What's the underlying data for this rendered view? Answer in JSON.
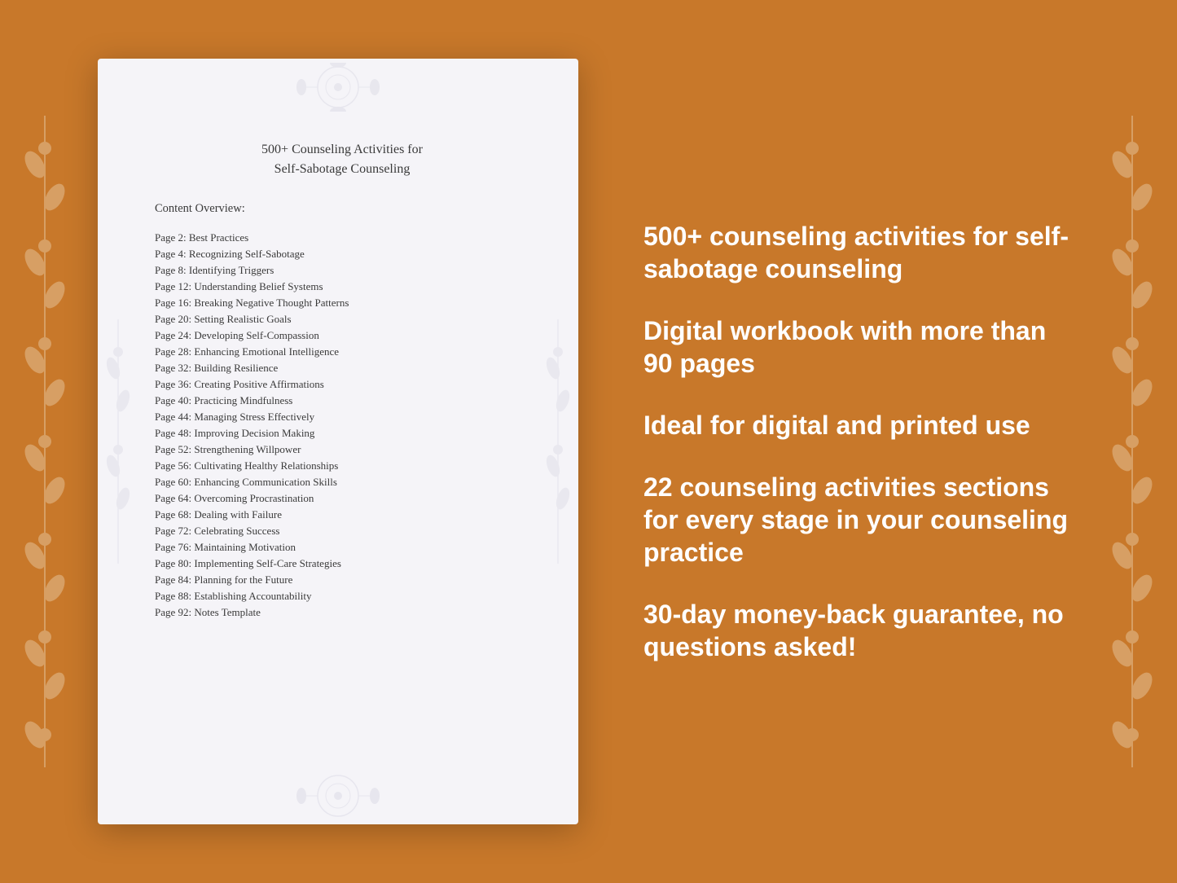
{
  "document": {
    "title_line1": "500+ Counseling Activities for",
    "title_line2": "Self-Sabotage Counseling",
    "section_label": "Content Overview:",
    "toc": [
      {
        "page": "Page  2:",
        "title": "Best Practices"
      },
      {
        "page": "Page  4:",
        "title": "Recognizing Self-Sabotage"
      },
      {
        "page": "Page  8:",
        "title": "Identifying Triggers"
      },
      {
        "page": "Page 12:",
        "title": "Understanding Belief Systems"
      },
      {
        "page": "Page 16:",
        "title": "Breaking Negative Thought Patterns"
      },
      {
        "page": "Page 20:",
        "title": "Setting Realistic Goals"
      },
      {
        "page": "Page 24:",
        "title": "Developing Self-Compassion"
      },
      {
        "page": "Page 28:",
        "title": "Enhancing Emotional Intelligence"
      },
      {
        "page": "Page 32:",
        "title": "Building Resilience"
      },
      {
        "page": "Page 36:",
        "title": "Creating Positive Affirmations"
      },
      {
        "page": "Page 40:",
        "title": "Practicing Mindfulness"
      },
      {
        "page": "Page 44:",
        "title": "Managing Stress Effectively"
      },
      {
        "page": "Page 48:",
        "title": "Improving Decision Making"
      },
      {
        "page": "Page 52:",
        "title": "Strengthening Willpower"
      },
      {
        "page": "Page 56:",
        "title": "Cultivating Healthy Relationships"
      },
      {
        "page": "Page 60:",
        "title": "Enhancing Communication Skills"
      },
      {
        "page": "Page 64:",
        "title": "Overcoming Procrastination"
      },
      {
        "page": "Page 68:",
        "title": "Dealing with Failure"
      },
      {
        "page": "Page 72:",
        "title": "Celebrating Success"
      },
      {
        "page": "Page 76:",
        "title": "Maintaining Motivation"
      },
      {
        "page": "Page 80:",
        "title": "Implementing Self-Care Strategies"
      },
      {
        "page": "Page 84:",
        "title": "Planning for the Future"
      },
      {
        "page": "Page 88:",
        "title": "Establishing Accountability"
      },
      {
        "page": "Page 92:",
        "title": "Notes Template"
      }
    ]
  },
  "features": [
    "500+ counseling activities for self-sabotage counseling",
    "Digital workbook with more than 90 pages",
    "Ideal for digital and printed use",
    "22 counseling activities sections for every stage in your counseling practice",
    "30-day money-back guarantee, no questions asked!"
  ]
}
